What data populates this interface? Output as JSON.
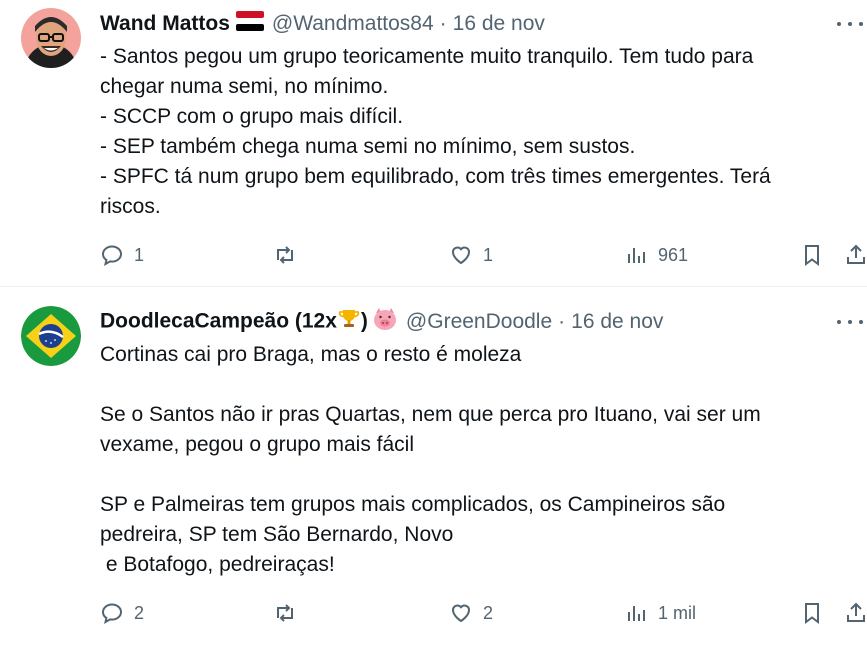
{
  "tweets": [
    {
      "author": {
        "name": "Wand Mattos",
        "handle": "@Wandmattos84",
        "flag": "yemen-flag"
      },
      "separator": "·",
      "date": "16 de nov",
      "body": [
        "- Santos pegou um grupo teoricamente muito tranquilo. Tem tudo para",
        "chegar numa semi, no mínimo.",
        "- SCCP com o grupo mais difícil.",
        "- SEP também chega numa semi no mínimo, sem sustos.",
        "- SPFC tá num grupo bem equilibrado, com três times emergentes. Terá",
        "riscos."
      ],
      "actions": {
        "replies": "1",
        "reposts": "",
        "likes": "1",
        "views": "961"
      }
    },
    {
      "author": {
        "name": "DoodlecaCampeão (12x",
        "name_suffix": ")",
        "handle": "@GreenDoodle"
      },
      "separator": "·",
      "date": "16 de nov",
      "body": [
        "Cortinas cai pro Braga, mas o resto é moleza",
        "",
        "Se o Santos não ir pras Quartas, nem que perca pro Ituano, vai ser um",
        "vexame, pegou o grupo mais fácil",
        "",
        "SP e Palmeiras tem grupos mais complicados, os Campineiros são",
        "pedreira, SP tem São Bernardo, Novo",
        " e Botafogo, pedreiraças!"
      ],
      "actions": {
        "replies": "2",
        "reposts": "",
        "likes": "2",
        "views": "1 mil"
      }
    }
  ],
  "colors": {
    "text": "#0f1419",
    "secondary": "#536471",
    "divider": "#eff3f4"
  },
  "icons": [
    "reply-icon",
    "repost-icon",
    "like-icon",
    "views-icon",
    "bookmark-icon",
    "share-icon",
    "more-icon",
    "trophy-icon",
    "pig-icon",
    "yemen-flag"
  ]
}
